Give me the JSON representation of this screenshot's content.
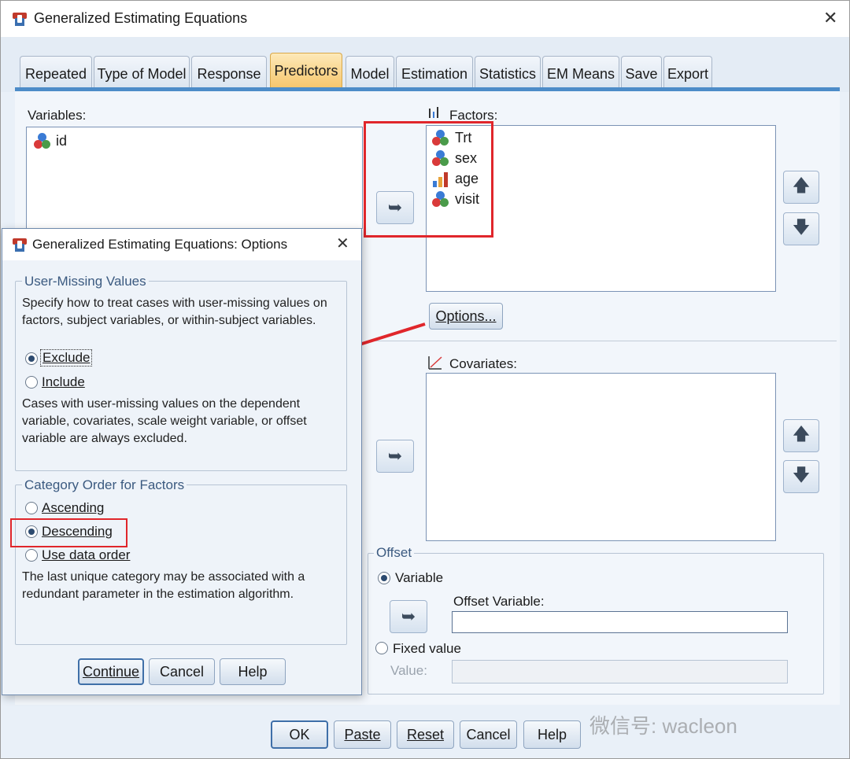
{
  "window": {
    "title": "Generalized Estimating Equations",
    "close_icon": "close-icon"
  },
  "tabs": [
    {
      "label": "Repeated"
    },
    {
      "label": "Type of Model"
    },
    {
      "label": "Response"
    },
    {
      "label": "Predictors"
    },
    {
      "label": "Model"
    },
    {
      "label": "Estimation"
    },
    {
      "label": "Statistics"
    },
    {
      "label": "EM Means"
    },
    {
      "label": "Save"
    },
    {
      "label": "Export"
    }
  ],
  "active_tab": "Predictors",
  "variables": {
    "label": "Variables:",
    "items": [
      {
        "name": "id",
        "icon": "nominal-icon"
      }
    ]
  },
  "factors": {
    "label": "Factors:",
    "items": [
      {
        "name": "Trt",
        "icon": "nominal-icon"
      },
      {
        "name": "sex",
        "icon": "nominal-icon"
      },
      {
        "name": "age",
        "icon": "scale-icon"
      },
      {
        "name": "visit",
        "icon": "nominal-icon"
      }
    ],
    "options_button": "Options..."
  },
  "covariates": {
    "label": "Covariates:",
    "items": []
  },
  "offset": {
    "title": "Offset",
    "variable_radio": "Variable",
    "offset_variable_label": "Offset Variable:",
    "offset_variable_value": "",
    "fixed_value_radio": "Fixed value",
    "value_label": "Value:",
    "value_value": ""
  },
  "bottom_buttons": {
    "ok": "OK",
    "paste": "Paste",
    "reset": "Reset",
    "cancel": "Cancel",
    "help": "Help"
  },
  "options_dialog": {
    "title": "Generalized Estimating Equations: Options",
    "user_missing": {
      "title": "User-Missing Values",
      "description": "Specify how to treat cases with user-missing values on factors, subject variables, or within-subject variables.",
      "exclude": "Exclude",
      "include": "Include",
      "note": "Cases with user-missing values on the dependent variable, covariates, scale weight variable, or offset variable are always excluded."
    },
    "category_order": {
      "title": "Category Order for Factors",
      "ascending": "Ascending",
      "descending": "Descending",
      "use_data_order": "Use data order",
      "note": "The last unique category may be associated with a redundant parameter in the estimation algorithm."
    },
    "buttons": {
      "continue": "Continue",
      "cancel": "Cancel",
      "help": "Help"
    }
  },
  "watermark": "微信号: wacleon",
  "colors": {
    "accent_tab": "#f6c56a",
    "tab_line": "#4d8cc8",
    "highlight_red": "#e0262b"
  }
}
